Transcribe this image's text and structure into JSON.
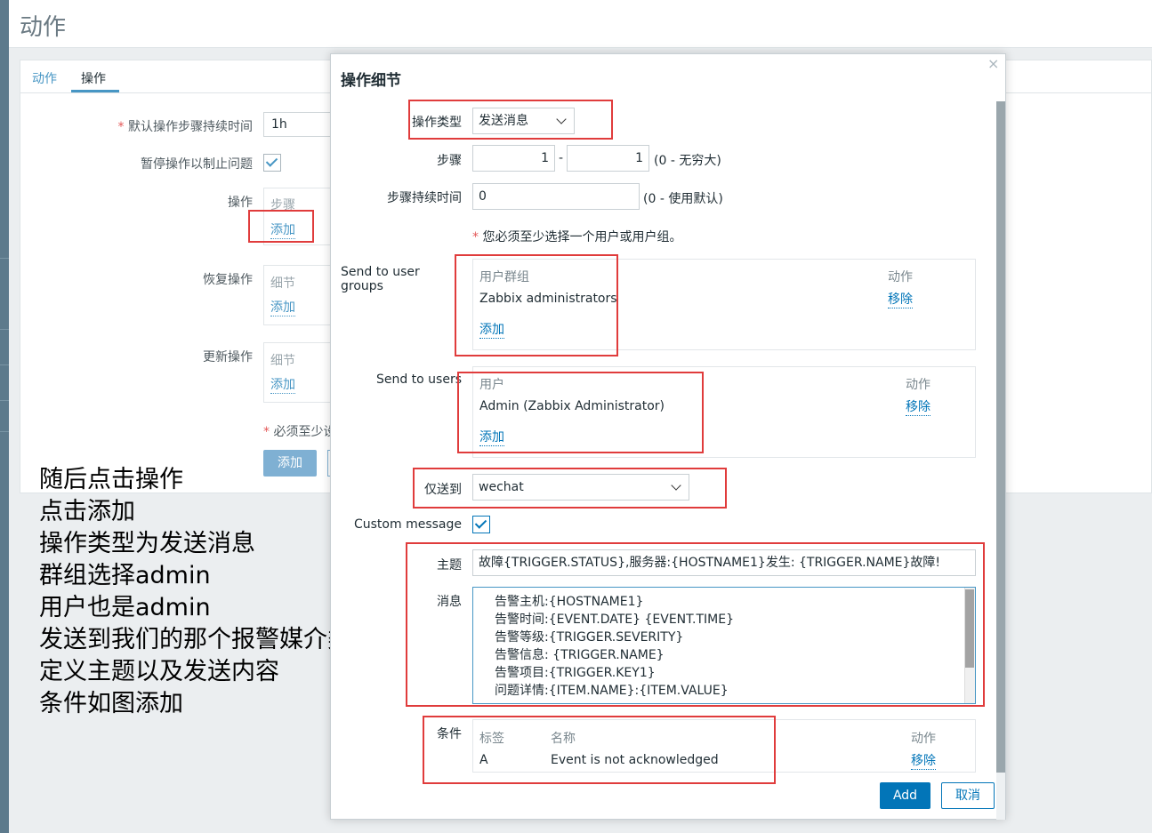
{
  "page": {
    "title": "动作",
    "tabs": [
      "动作",
      "操作"
    ]
  },
  "background_form": {
    "default_duration_label": "默认操作步骤持续时间",
    "default_duration_value": "1h",
    "pause_label": "暂停操作以制止问题",
    "operations_label": "操作",
    "operations_col": "步骤",
    "recovery_label": "恢复操作",
    "update_label": "更新操作",
    "details_col": "细节",
    "add_link": "添加",
    "required_note": "必须至少设",
    "add_button": "添加"
  },
  "annotations": [
    "随后点击操作",
    "点击添加",
    "操作类型为发送消息",
    "群组选择admin",
    "用户也是admin",
    "发送到我们的那个报警媒介类型上",
    "定义主题以及发送内容",
    "条件如图添加"
  ],
  "modal": {
    "title": "操作细节",
    "close": "×",
    "operation_type_label": "操作类型",
    "operation_type_value": "发送消息",
    "steps_label": "步骤",
    "step_from": "1",
    "step_sep": "-",
    "step_to": "1",
    "steps_hint": "(0 - 无穷大)",
    "step_duration_label": "步骤持续时间",
    "step_duration_value": "0",
    "step_duration_hint": "(0 - 使用默认)",
    "must_select_note": "您必须至少选择一个用户或用户组。",
    "user_groups_label": "Send to user groups",
    "user_groups_col_group": "用户群组",
    "user_groups_col_action": "动作",
    "user_group_name": "Zabbix administrators",
    "remove_link": "移除",
    "add_link": "添加",
    "users_label": "Send to users",
    "users_col_user": "用户",
    "users_col_action": "动作",
    "user_name": "Admin (Zabbix Administrator)",
    "send_only_label": "仅送到",
    "send_only_value": "wechat",
    "custom_message_label": "Custom message",
    "subject_label": "主题",
    "subject_value": "故障{TRIGGER.STATUS},服务器:{HOSTNAME1}发生: {TRIGGER.NAME}故障!",
    "message_label": "消息",
    "message_lines": [
      "告警主机:{HOSTNAME1}",
      "告警时间:{EVENT.DATE} {EVENT.TIME}",
      "告警等级:{TRIGGER.SEVERITY}",
      "告警信息: {TRIGGER.NAME}",
      "告警项目:{TRIGGER.KEY1}",
      "问题详情:{ITEM.NAME}:{ITEM.VALUE}"
    ],
    "conditions_label": "条件",
    "cond_col_label": "标签",
    "cond_col_name": "名称",
    "cond_col_action": "动作",
    "cond_label": "A",
    "cond_name": "Event is not acknowledged",
    "add_button": "Add",
    "cancel_button": "取消"
  }
}
